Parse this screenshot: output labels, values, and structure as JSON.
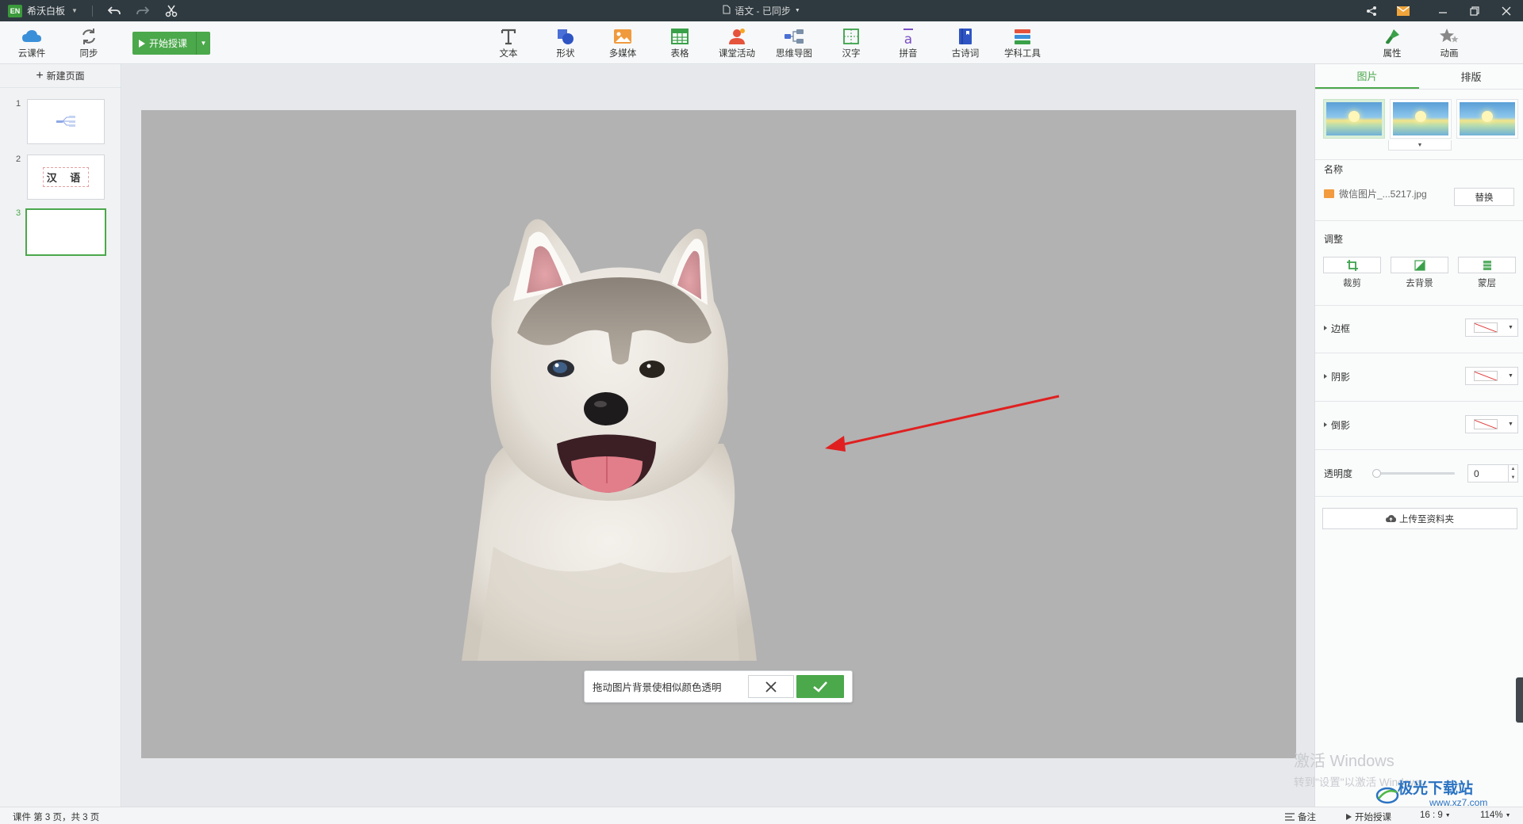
{
  "titlebar": {
    "logo": "EN",
    "app_name": "希沃白板",
    "doc_title": "语文 - 已同步",
    "icons": [
      "undo-icon",
      "redo-icon",
      "scissors-icon",
      "share-icon",
      "mail-icon",
      "minimize-icon",
      "restore-icon",
      "close-icon"
    ]
  },
  "toolbar": {
    "cloud_label": "云课件",
    "sync_label": "同步",
    "start_label": "开始授课",
    "tools": [
      {
        "label": "文本",
        "icon": "text-T-icon"
      },
      {
        "label": "形状",
        "icon": "shape-icon"
      },
      {
        "label": "多媒体",
        "icon": "media-icon"
      },
      {
        "label": "表格",
        "icon": "table-icon"
      },
      {
        "label": "课堂活动",
        "icon": "classroom-activity-icon"
      },
      {
        "label": "思维导图",
        "icon": "mindmap-icon"
      },
      {
        "label": "汉字",
        "icon": "hanzi-icon"
      },
      {
        "label": "拼音",
        "icon": "pinyin-icon"
      },
      {
        "label": "古诗词",
        "icon": "poetry-icon"
      },
      {
        "label": "学科工具",
        "icon": "subject-tools-icon"
      }
    ],
    "properties_label": "属性",
    "animation_label": "动画"
  },
  "pages": {
    "new_page_label": "新建页面",
    "items": [
      {
        "num": "1",
        "thumb_text": ""
      },
      {
        "num": "2",
        "thumb_text": "汉 语"
      },
      {
        "num": "3",
        "thumb_text": ""
      }
    ],
    "active": 3
  },
  "canvas": {
    "popup_message": "拖动图片背景使相似颜色透明",
    "annotation_color": "#e02020",
    "slide_bg": "#b2b2b2"
  },
  "panel": {
    "tab_picture": "图片",
    "tab_layout": "排版",
    "name_label": "名称",
    "file_name": "微信图片_...5217.jpg",
    "replace_label": "替换",
    "adjust_label": "调整",
    "crop_label": "裁剪",
    "remove_bg_label": "去背景",
    "mask_label": "蒙层",
    "border_label": "边框",
    "shadow_label": "阴影",
    "reflection_label": "倒影",
    "opacity_label": "透明度",
    "opacity_value": "0",
    "upload_label": "上传至资料夹"
  },
  "status": {
    "page_info": "课件 第 3 页，共 3 页",
    "notes_label": "备注",
    "start_label": "开始授课",
    "ratio": "16 : 9",
    "zoom": "114%"
  },
  "watermark": {
    "line1": "激活 Windows",
    "line2": "转到\"设置\"以激活 Windows。",
    "site": "极光下载站",
    "site_url": "www.xz7.com"
  },
  "colors": {
    "accent": "#4ba84b",
    "titlebar": "#2e3a40"
  }
}
